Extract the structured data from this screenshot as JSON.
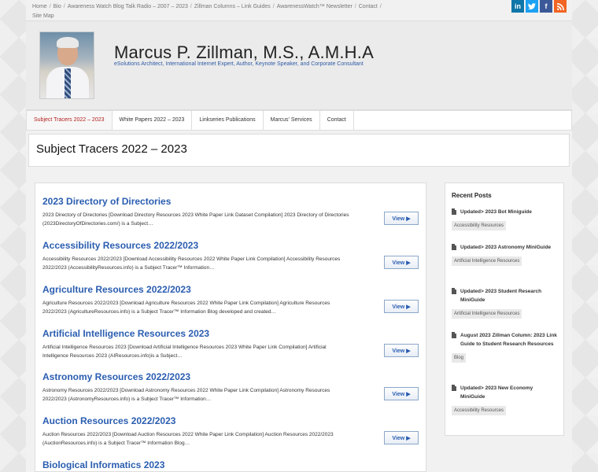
{
  "topnav": {
    "items": [
      "Home",
      "Bio",
      "Awareness Watch Blog Talk Radio – 2007 – 2023",
      "Zillman Columns – Link Guides",
      "AwarenessWatch™ Newsletter",
      "Contact",
      "Site Map"
    ]
  },
  "social": {
    "linkedin": "in",
    "twitter": "t",
    "facebook": "f",
    "rss": "rss"
  },
  "colors": {
    "linkedin": "#0e76a8",
    "twitter": "#1da1f2",
    "facebook": "#3b5998",
    "rss": "#f26522",
    "link": "#2a5db0",
    "active": "#b41e1e"
  },
  "header": {
    "name": "Marcus P. Zillman, M.S., A.M.H.A",
    "tagline": "eSolutions Architect, International Internet Expert, Author, Keynote Speaker, and Corporate Consultant"
  },
  "menu": {
    "items": [
      "Subject Tracers 2022 – 2023",
      "White Papers 2022 – 2023",
      "Linkseries Publications",
      "Marcus' Services",
      "Contact"
    ]
  },
  "page": {
    "title": "Subject Tracers 2022 – 2023"
  },
  "view_label": "View ▶",
  "posts": [
    {
      "title": "2023 Directory of Directories",
      "excerpt": "2023 Directory of Directories [Download Directory Resources 2023 White Paper Link Dataset Compilation] 2023 Directory of Directories (2023DirectoryOfDirectories.com/) is a Subject…"
    },
    {
      "title": "Accessibility Resources 2022/2023",
      "excerpt": "Accessibility Resources 2022/2023 [Download Accessibility Resources 2022 White Paper Link Compilation] Accessibility Resources 2022/2023 (AccessibilityResources.info) is a Subject Tracer™ Information…"
    },
    {
      "title": "Agriculture Resources 2022/2023",
      "excerpt": "Agriculture Resources 2022/2023 [Download Agriculture Resources 2022 White Paper Link Compilation] Agriculture Resources 2022/2023 (AgricultureResources.info) is a Subject Tracer™ Information Blog developed and created…"
    },
    {
      "title": "Artificial Intelligence Resources 2023",
      "excerpt": "Artificial Intelligence Resources 2023 [Download Artificial Intelligence Resources 2023 White Paper Link Compilation] Artificial Intelligence Resources 2023 (AIResources.info)is a Subject…"
    },
    {
      "title": "Astronomy Resources 2022/2023",
      "excerpt": "Astronomy Resources 2022/2023 [Download Astronomy Resources 2022 White Paper Link Compilation] Astronomy Resources 2022/2023 (AstronomyResources.info) is a Subject Tracer™ Information…"
    },
    {
      "title": "Auction Resources 2022/2023",
      "excerpt": "Auction Resources 2022/2023 [Download Auction Resources 2022 White Paper Link Compilation] Auction Resources 2022/2023 (AuctionResources.info) is a Subject Tracer™ Information Blog…"
    },
    {
      "title": "Biological Informatics 2023",
      "excerpt": ""
    }
  ],
  "sidebar": {
    "heading": "Recent Posts",
    "items": [
      {
        "title": "Updated> 2023 Bot Miniguide",
        "tag": "Accessibility Resources"
      },
      {
        "title": "Updated> 2023 Astronomy MiniGuide",
        "tag": "Artificial Intelligence Resources"
      },
      {
        "title": "Updated> 2023 Student Research MiniGuide",
        "tag": "Artificial Intelligence Resources"
      },
      {
        "title": "August 2023 Zillman Column: 2023 Link Guide to Student Research Resources",
        "tag": "Blog"
      },
      {
        "title": "Updated> 2023 New Economy MiniGuide",
        "tag": "Accessibility Resources"
      }
    ]
  }
}
